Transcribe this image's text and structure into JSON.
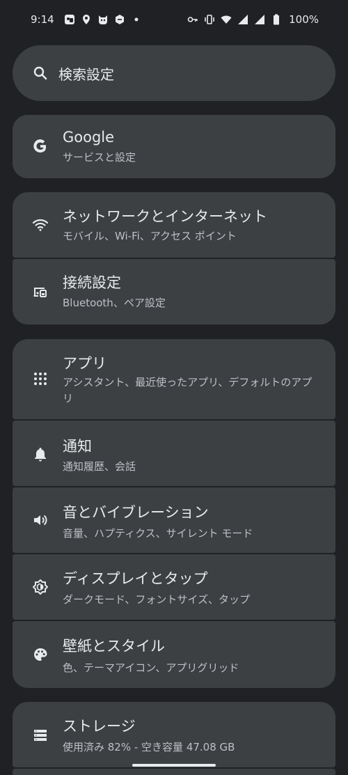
{
  "status_bar": {
    "time": "9:14",
    "battery_percent": "100%",
    "left_icons": [
      "photos-icon",
      "location-icon",
      "cat-app-icon",
      "hexagon-app-icon",
      "dot-icon"
    ],
    "right_icons": [
      "vpn-key-icon",
      "vibrate-icon",
      "wifi-icon",
      "signal-icon",
      "signal-icon",
      "battery-icon"
    ]
  },
  "search": {
    "placeholder": "検索設定"
  },
  "sections": {
    "google": {
      "title": "Google",
      "summary": "サービスと設定"
    },
    "network": {
      "title": "ネットワークとインターネット",
      "summary": "モバイル、Wi-Fi、アクセス ポイント"
    },
    "connected": {
      "title": "接続設定",
      "summary": "Bluetooth、ペア設定"
    },
    "apps": {
      "title": "アプリ",
      "summary": "アシスタント、最近使ったアプリ、デフォルトのアプリ"
    },
    "notifications": {
      "title": "通知",
      "summary": "通知履歴、会話"
    },
    "sound": {
      "title": "音とバイブレーション",
      "summary": "音量、ハプティクス、サイレント モード"
    },
    "display": {
      "title": "ディスプレイとタップ",
      "summary": "ダークモード、フォントサイズ、タップ"
    },
    "wallpaper": {
      "title": "壁紙とスタイル",
      "summary": "色、テーマアイコン、アプリグリッド"
    },
    "storage": {
      "title": "ストレージ",
      "summary": "使用済み 82% - 空き容量 47.08 GB"
    }
  },
  "colors": {
    "background": "#202124",
    "card": "#3c4043",
    "text_primary": "#e8eaed",
    "text_secondary": "#bdc1c6"
  }
}
